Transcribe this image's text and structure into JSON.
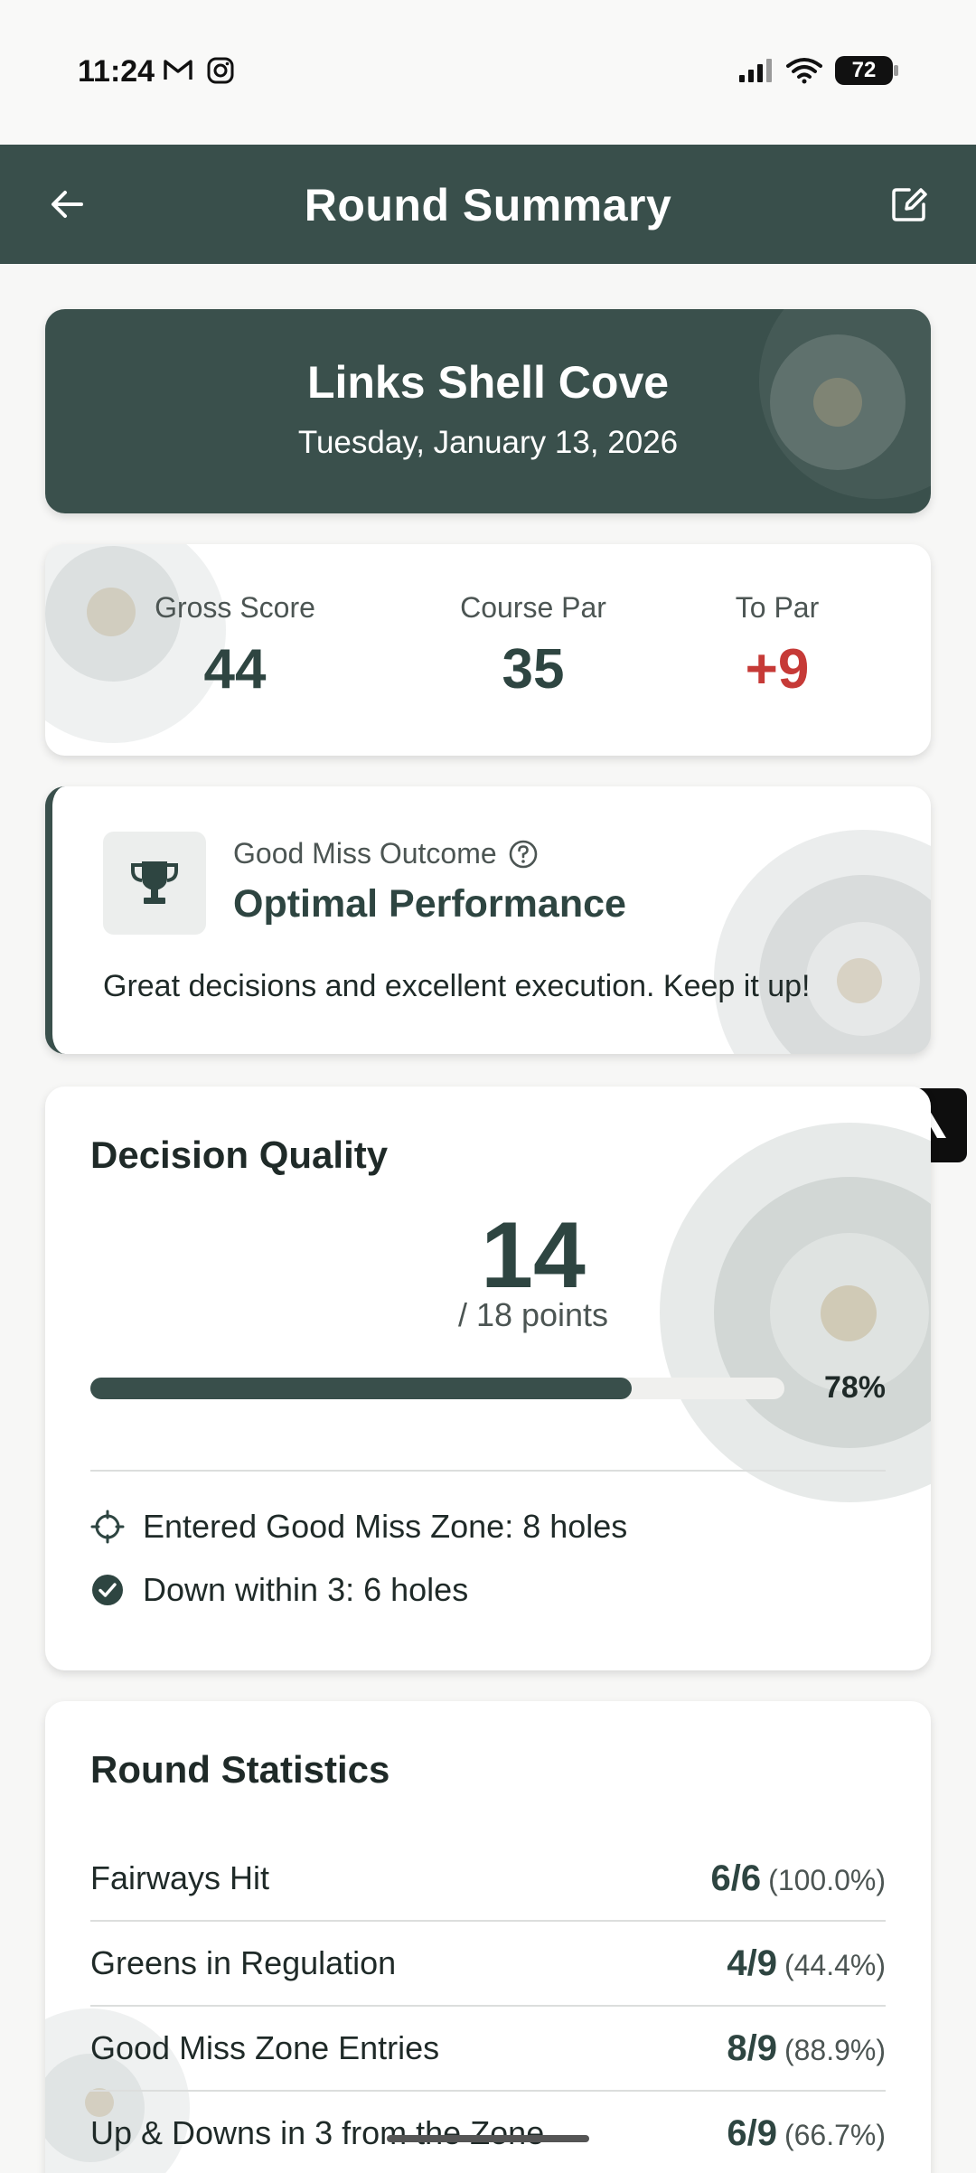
{
  "status_bar": {
    "time": "11:24",
    "battery": "72",
    "left_icons": [
      "gmail-icon",
      "instagram-icon"
    ],
    "right_icons": [
      "signal-icon",
      "wifi-icon",
      "battery-icon"
    ]
  },
  "app_bar": {
    "title": "Round Summary",
    "back_icon": "arrow-left-icon",
    "edit_icon": "edit-icon"
  },
  "course": {
    "name": "Links Shell Cove",
    "date": "Tuesday, January 13, 2026"
  },
  "scores": [
    {
      "label": "Gross Score",
      "value": "44"
    },
    {
      "label": "Course Par",
      "value": "35"
    },
    {
      "label": "To Par",
      "value": "+9"
    }
  ],
  "outcome": {
    "label": "Good Miss Outcome",
    "title": "Optimal Performance",
    "description": "Great decisions and excellent execution. Keep it up!",
    "icon": "trophy-icon"
  },
  "decision_quality": {
    "title": "Decision Quality",
    "points": "14",
    "points_sub": "/ 18 points",
    "progress": 0.78,
    "progress_label": "78%",
    "items": [
      {
        "icon": "crosshair-icon",
        "text": "Entered Good Miss Zone: 8 holes"
      },
      {
        "icon": "check-circle-icon",
        "text": "Down within 3: 6 holes"
      }
    ]
  },
  "round_statistics": {
    "title": "Round Statistics",
    "rows": [
      {
        "name": "Fairways Hit",
        "value": "6/6",
        "pct": "(100.0%)"
      },
      {
        "name": "Greens in Regulation",
        "value": "4/9",
        "pct": "(44.4%)"
      },
      {
        "name": "Good Miss Zone Entries",
        "value": "8/9",
        "pct": "(88.9%)"
      },
      {
        "name": "Up & Downs in 3 from the Zone",
        "value": "6/9",
        "pct": "(66.7%)"
      }
    ]
  },
  "colors": {
    "primary": "#394f4b",
    "accent_red": "#c63a37",
    "background": "#f7f7f6"
  }
}
